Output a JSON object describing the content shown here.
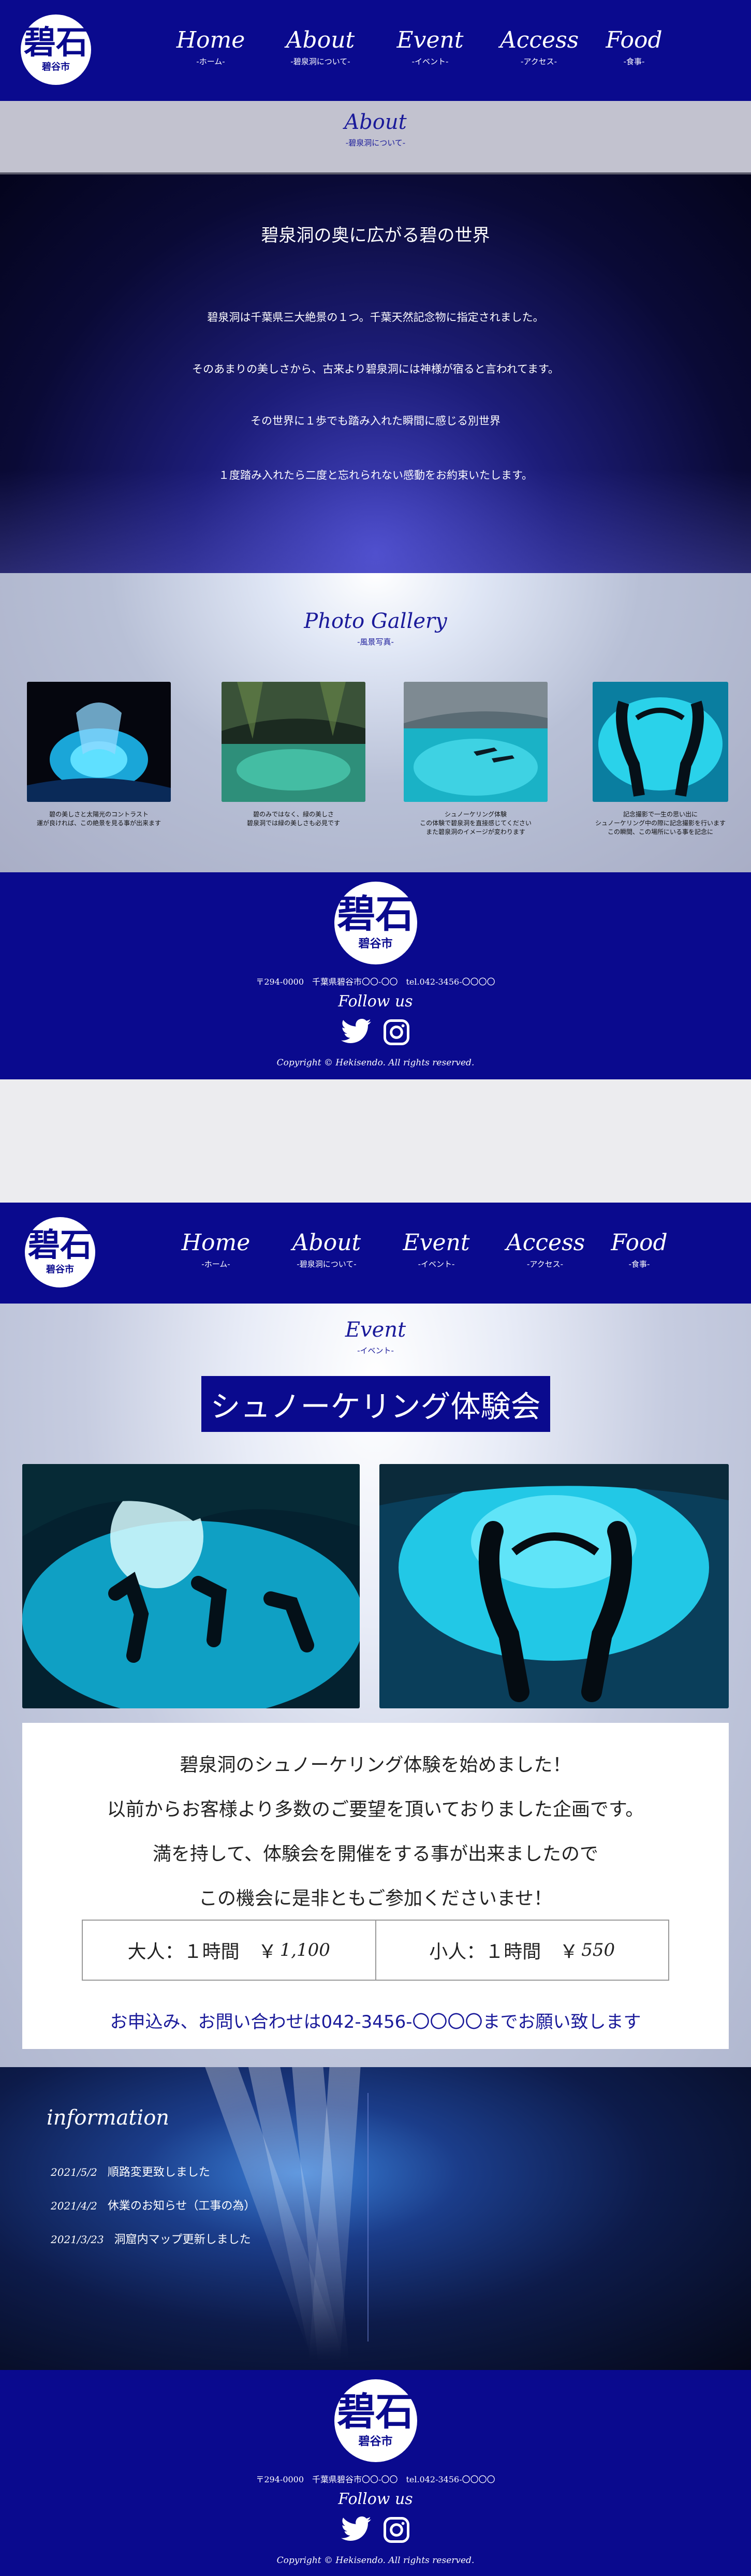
{
  "brand": {
    "logo_big": "碧石",
    "logo_small": "碧谷市"
  },
  "nav": [
    {
      "en": "Home",
      "jp": "-ホーム-"
    },
    {
      "en": "About",
      "jp": "-碧泉洞について-"
    },
    {
      "en": "Event",
      "jp": "-イベント-"
    },
    {
      "en": "Access",
      "jp": "-アクセス-"
    },
    {
      "en": "Food",
      "jp": "-食事-"
    }
  ],
  "about": {
    "heading_en": "About",
    "heading_jp": "-碧泉洞について-",
    "title": "碧泉洞の奥に広がる碧の世界",
    "paragraphs": [
      "碧泉洞は千葉県三大絶景の１つ。千葉天然記念物に指定されました。",
      "そのあまりの美しさから、古来より碧泉洞には神様が宿ると言われてます。",
      "その世界に１歩でも踏み入れた瞬間に感じる別世界",
      "１度踏み入れたら二度と忘れられない感動をお約束いたします。"
    ]
  },
  "gallery": {
    "heading_en": "Photo Gallery",
    "heading_jp": "-風景写真-",
    "items": [
      {
        "caption1": "碧の美しさと太陽光のコントラスト",
        "caption2": "運が良ければ、この絶景を見る事が出来ます"
      },
      {
        "caption1": "碧のみではなく、緑の美しさ",
        "caption2": "碧泉洞では緑の美しさも必見です"
      },
      {
        "caption1": "シュノーケリング体験",
        "caption2": "この体験で碧泉洞を直接感じてください",
        "caption3": "また碧泉洞のイメージが変わります"
      },
      {
        "caption1": "記念撮影で一生の思い出に",
        "caption2": "シュノーケリング中の際に記念撮影を行います",
        "caption3": "この瞬間、この場所にいる事を記念に"
      }
    ]
  },
  "footer": {
    "address": "〒294-0000　千葉県碧谷市〇〇-〇〇　tel.042-3456-〇〇〇〇",
    "follow": "Follow us",
    "copyright": "Copyright © Hekisendo. All rights reserved.",
    "icons": [
      "twitter-icon",
      "instagram-icon"
    ]
  },
  "event": {
    "heading_en": "Event",
    "heading_jp": "-イベント-",
    "title": "シュノーケリング体験会",
    "lines": [
      "碧泉洞のシュノーケリング体験を始めました！",
      "以前からお客様より多数のご要望を頂いておりました企画です。",
      "満を持して、体験会を開催をする事が出来ましたので",
      "この機会に是非ともご参加くださいませ！"
    ],
    "price_adult_label": "大人：１時間　￥",
    "price_adult_value": "1,100",
    "price_child_label": "小人：１時間　￥",
    "price_child_value": "550",
    "contact": "お申込み、お問い合わせは042-3456-〇〇〇〇までお願い致します"
  },
  "info": {
    "title": "information",
    "items": [
      {
        "date": "2021/5/2",
        "text": "順路変更致しました"
      },
      {
        "date": "2021/4/2",
        "text": "休業のお知らせ（工事の為）"
      },
      {
        "date": "2021/3/23",
        "text": "洞窟内マップ更新しました"
      }
    ]
  },
  "colors": {
    "brand": "#0a0a8e",
    "white": "#ffffff"
  }
}
